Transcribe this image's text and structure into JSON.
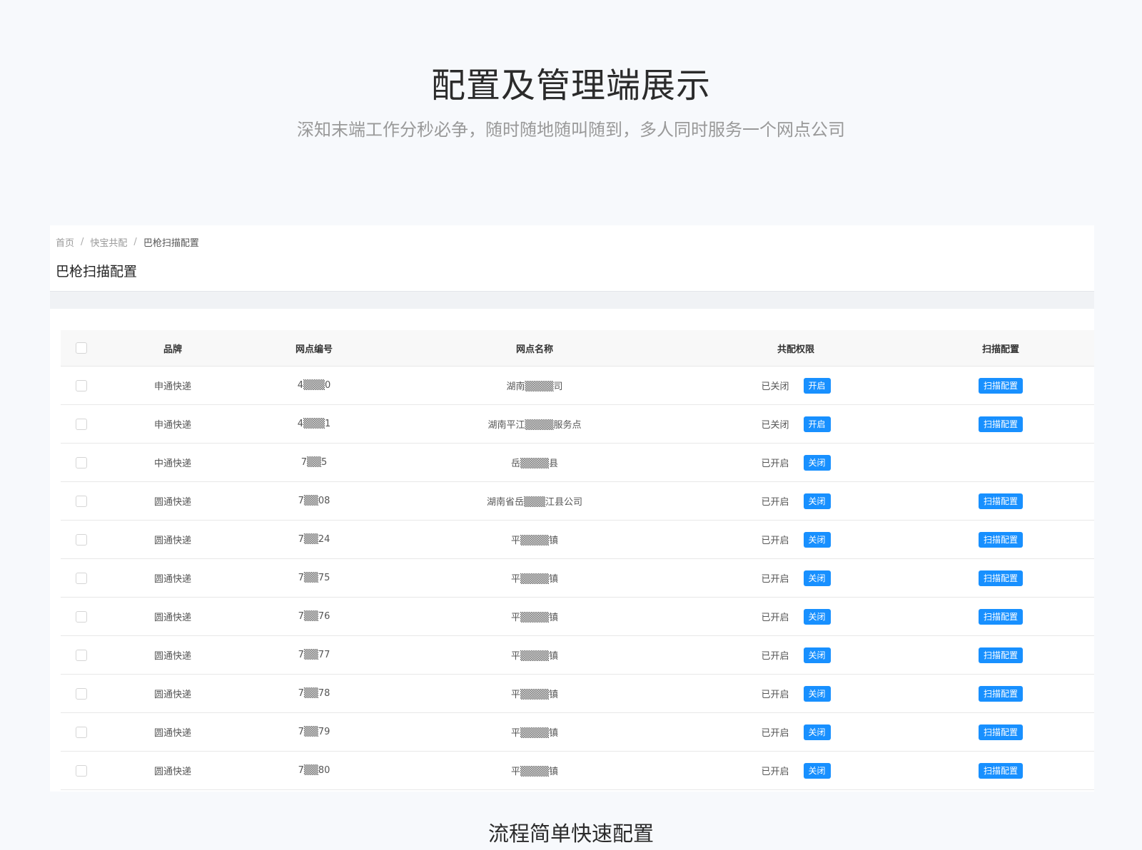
{
  "hero": {
    "title": "配置及管理端展示",
    "subtitle": "深知末端工作分秒必争，随时随地随叫随到，多人同时服务一个网点公司"
  },
  "breadcrumb": {
    "items": [
      "首页",
      "快宝共配",
      "巴枪扫描配置"
    ],
    "separator": "/"
  },
  "page_title": "巴枪扫描配置",
  "table": {
    "headers": [
      "品牌",
      "网点编号",
      "网点名称",
      "共配权限",
      "扫描配置"
    ],
    "rows": [
      {
        "brand": "申通快递",
        "code": "4▒▒▒0",
        "name": "湖南▒▒▒▒司",
        "status": "已关闭",
        "action": "开启",
        "scan": "扫描配置"
      },
      {
        "brand": "申通快递",
        "code": "4▒▒▒1",
        "name": "湖南平江▒▒▒▒服务点",
        "status": "已关闭",
        "action": "开启",
        "scan": "扫描配置"
      },
      {
        "brand": "中通快递",
        "code": "7▒▒5",
        "name": "岳▒▒▒▒县",
        "status": "已开启",
        "action": "关闭",
        "scan": ""
      },
      {
        "brand": "圆通快递",
        "code": "7▒▒08",
        "name": "湖南省岳▒▒▒江县公司",
        "status": "已开启",
        "action": "关闭",
        "scan": "扫描配置"
      },
      {
        "brand": "圆通快递",
        "code": "7▒▒24",
        "name": "平▒▒▒▒镇",
        "status": "已开启",
        "action": "关闭",
        "scan": "扫描配置"
      },
      {
        "brand": "圆通快递",
        "code": "7▒▒75",
        "name": "平▒▒▒▒镇",
        "status": "已开启",
        "action": "关闭",
        "scan": "扫描配置"
      },
      {
        "brand": "圆通快递",
        "code": "7▒▒76",
        "name": "平▒▒▒▒镇",
        "status": "已开启",
        "action": "关闭",
        "scan": "扫描配置"
      },
      {
        "brand": "圆通快递",
        "code": "7▒▒77",
        "name": "平▒▒▒▒镇",
        "status": "已开启",
        "action": "关闭",
        "scan": "扫描配置"
      },
      {
        "brand": "圆通快递",
        "code": "7▒▒78",
        "name": "平▒▒▒▒镇",
        "status": "已开启",
        "action": "关闭",
        "scan": "扫描配置"
      },
      {
        "brand": "圆通快递",
        "code": "7▒▒79",
        "name": "平▒▒▒▒镇",
        "status": "已开启",
        "action": "关闭",
        "scan": "扫描配置"
      },
      {
        "brand": "圆通快递",
        "code": "7▒▒80",
        "name": "平▒▒▒▒镇",
        "status": "已开启",
        "action": "关闭",
        "scan": "扫描配置"
      }
    ]
  },
  "caption": "流程简单快速配置",
  "colors": {
    "accent": "#1890ff",
    "background": "#f7f9fc"
  }
}
